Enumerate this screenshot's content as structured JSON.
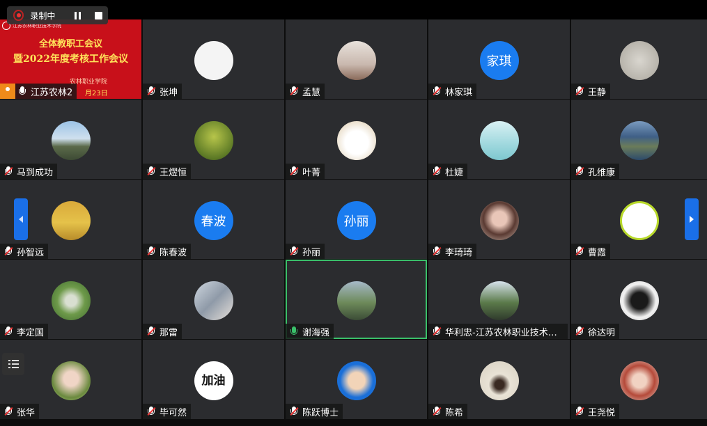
{
  "recording": {
    "status_label": "录制中"
  },
  "share": {
    "org_label": "江苏农林职业技术学院",
    "line1": "全体教职工会议",
    "line2": "暨2022年度考核工作会议",
    "line3": "农林职业学院",
    "line4": "月23日",
    "presenter": "江苏农林2"
  },
  "participants": [
    {
      "name": "张坤",
      "avatar_kind": "cartoon-boy"
    },
    {
      "name": "孟慧",
      "avatar_kind": "girl-photo"
    },
    {
      "name": "林家琪",
      "avatar_text": "家琪"
    },
    {
      "name": "王静",
      "avatar_kind": "sketch"
    },
    {
      "name": "马到成功",
      "avatar_kind": "landscape"
    },
    {
      "name": "王熤恒",
      "avatar_kind": "shadows-grass"
    },
    {
      "name": "叶菁",
      "avatar_kind": "white-dog"
    },
    {
      "name": "杜婕",
      "avatar_kind": "girl-illustration"
    },
    {
      "name": "孔维康",
      "avatar_kind": "town-lake"
    },
    {
      "name": "孙智远",
      "avatar_kind": "yellow-field"
    },
    {
      "name": "陈春波",
      "avatar_text": "春波"
    },
    {
      "name": "孙丽",
      "avatar_text": "孙丽"
    },
    {
      "name": "李琦琦",
      "avatar_kind": "woman-portrait"
    },
    {
      "name": "曹霞",
      "avatar_kind": "cartoon-logo"
    },
    {
      "name": "李定国",
      "avatar_kind": "plant"
    },
    {
      "name": "那雷",
      "avatar_kind": "couple-selfie"
    },
    {
      "name": "谢海强",
      "avatar_kind": "dandelion",
      "speaking": true
    },
    {
      "name": "华利忠-江苏农林职业技术学...",
      "avatar_kind": "man-outdoor"
    },
    {
      "name": "徐达明",
      "avatar_kind": "pug"
    },
    {
      "name": "张华",
      "avatar_kind": "woman-garden"
    },
    {
      "name": "毕可然",
      "avatar_text": "加油"
    },
    {
      "name": "陈跃博士",
      "avatar_kind": "man-blue-bg"
    },
    {
      "name": "陈希",
      "avatar_kind": "child-back"
    },
    {
      "name": "王尧悦",
      "avatar_kind": "little-girl"
    }
  ],
  "colors": {
    "tile_bg": "#2b2c2f",
    "avatar_blue": "#1a7cf0",
    "speaking_green": "#3ac06a",
    "muted_red": "#e33",
    "share_red": "#c8101a",
    "nav_blue": "#1a6fe8"
  }
}
